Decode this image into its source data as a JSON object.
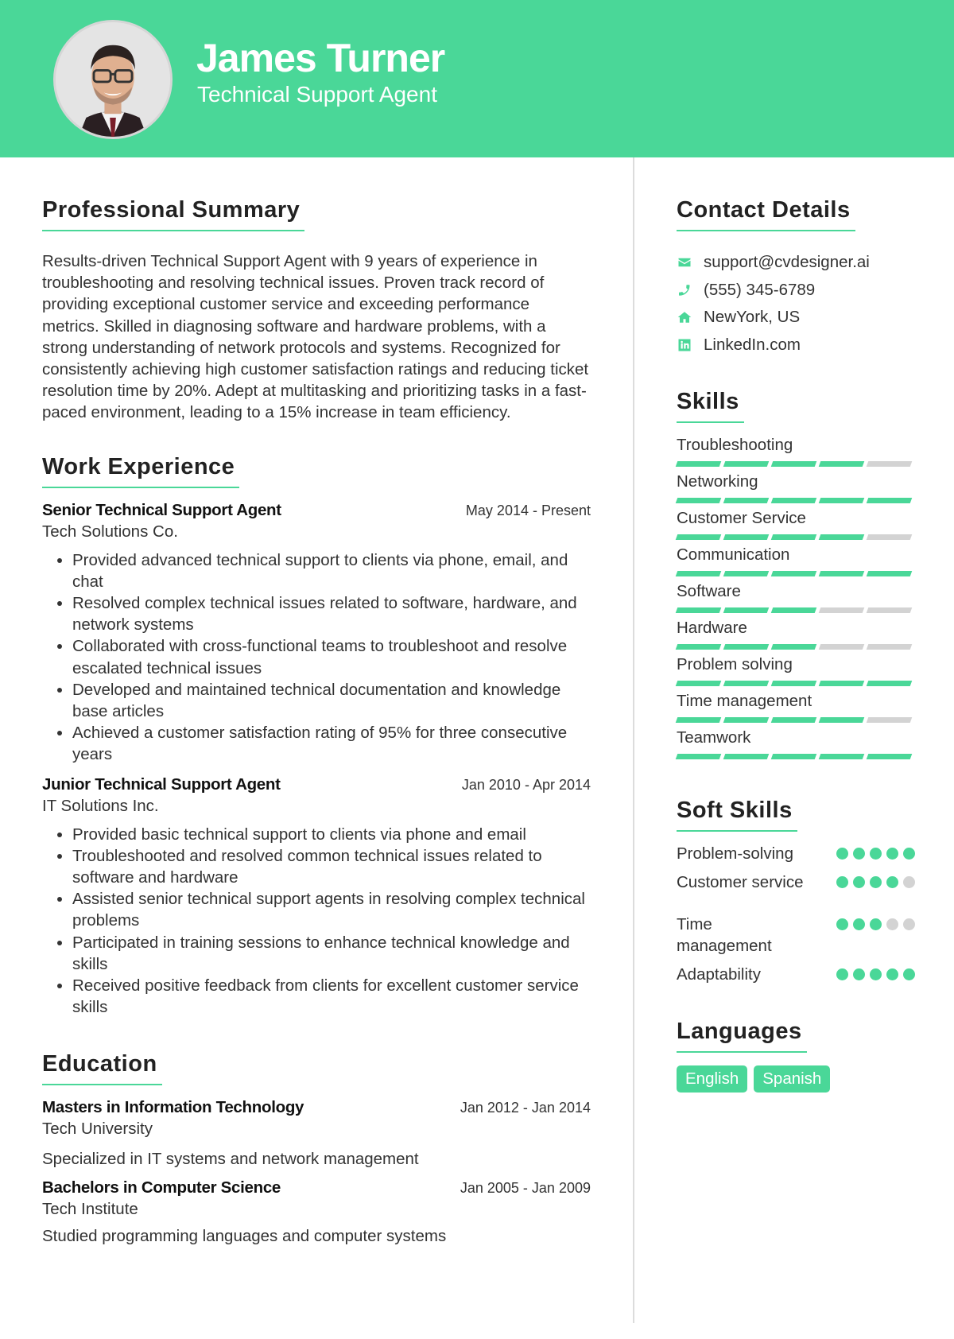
{
  "colors": {
    "accent": "#4ad798",
    "inactive": "#d3d3d3"
  },
  "header": {
    "name": "James Turner",
    "title": "Technical Support Agent"
  },
  "summary": {
    "heading": "Professional Summary",
    "text": "Results-driven Technical Support Agent with 9 years of experience in troubleshooting and resolving technical issues. Proven track record of providing exceptional customer service and exceeding performance metrics. Skilled in diagnosing software and hardware problems, with a strong understanding of network protocols and systems. Recognized for consistently achieving high customer satisfaction ratings and reducing ticket resolution time by 20%. Adept at multitasking and prioritizing tasks in a fast-paced environment, leading to a 15% increase in team efficiency."
  },
  "experience": {
    "heading": "Work Experience",
    "jobs": [
      {
        "role": "Senior Technical Support Agent",
        "date": "May 2014 - Present",
        "org": "Tech Solutions Co.",
        "bullets": [
          "Provided advanced technical support to clients via phone, email, and chat",
          "Resolved complex technical issues related to software, hardware, and network systems",
          "Collaborated with cross-functional teams to troubleshoot and resolve escalated technical issues",
          "Developed and maintained technical documentation and knowledge base articles",
          "Achieved a customer satisfaction rating of 95% for three consecutive years"
        ]
      },
      {
        "role": "Junior Technical Support Agent",
        "date": "Jan 2010 - Apr 2014",
        "org": "IT Solutions Inc.",
        "bullets": [
          "Provided basic technical support to clients via phone and email",
          "Troubleshooted and resolved common technical issues related to software and hardware",
          "Assisted senior technical support agents in resolving complex technical problems",
          "Participated in training sessions to enhance technical knowledge and skills",
          "Received positive feedback from clients for excellent customer service skills"
        ]
      }
    ]
  },
  "education": {
    "heading": "Education",
    "items": [
      {
        "degree": "Masters in Information Technology",
        "date": "Jan 2012 - Jan 2014",
        "school": "Tech University",
        "desc": "Specialized in IT systems and network management"
      },
      {
        "degree": "Bachelors in Computer Science",
        "date": "Jan 2005 - Jan 2009",
        "school": "Tech Institute",
        "desc": "Studied programming languages and computer systems"
      }
    ]
  },
  "contact": {
    "heading": "Contact Details",
    "items": [
      {
        "icon": "envelope-icon",
        "text": "support@cvdesigner.ai"
      },
      {
        "icon": "phone-icon",
        "text": "(555) 345-6789"
      },
      {
        "icon": "home-icon",
        "text": "NewYork, US"
      },
      {
        "icon": "linkedin-icon",
        "text": "LinkedIn.com"
      }
    ]
  },
  "skills": {
    "heading": "Skills",
    "max": 5,
    "items": [
      {
        "label": "Troubleshooting",
        "level": 4
      },
      {
        "label": "Networking",
        "level": 5
      },
      {
        "label": "Customer Service",
        "level": 4
      },
      {
        "label": "Communication",
        "level": 5
      },
      {
        "label": "Software",
        "level": 3
      },
      {
        "label": "Hardware",
        "level": 3
      },
      {
        "label": "Problem solving",
        "level": 5
      },
      {
        "label": "Time management",
        "level": 4
      },
      {
        "label": "Teamwork",
        "level": 5
      }
    ]
  },
  "soft_skills": {
    "heading": "Soft Skills",
    "max": 5,
    "items": [
      {
        "label": "Problem-solving",
        "level": 5
      },
      {
        "label": "Customer service",
        "level": 4
      },
      {
        "label": "Time management",
        "level": 3
      },
      {
        "label": "Adaptability",
        "level": 5
      }
    ]
  },
  "languages": {
    "heading": "Languages",
    "items": [
      "English",
      "Spanish"
    ]
  }
}
